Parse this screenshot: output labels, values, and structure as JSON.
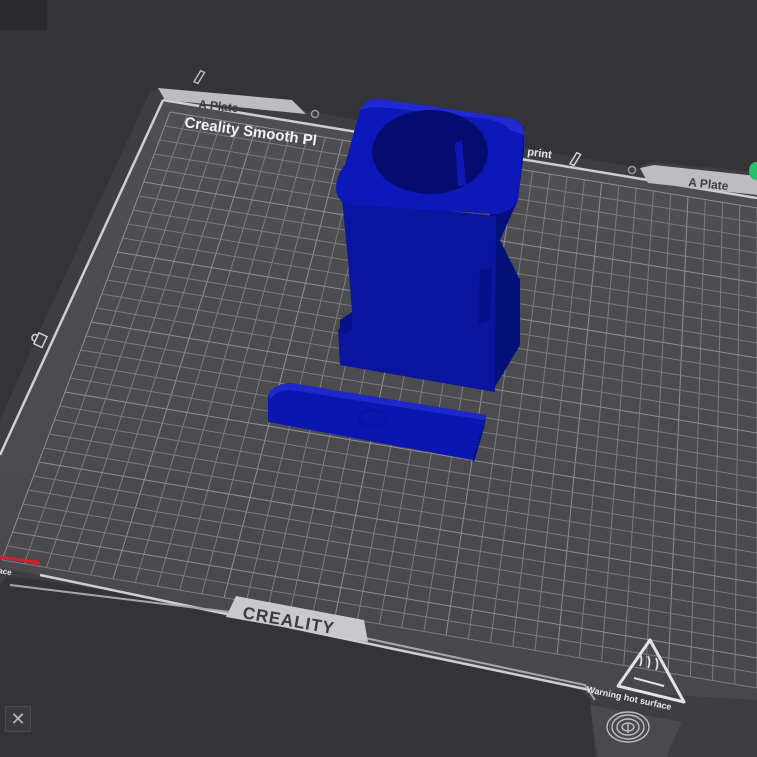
{
  "plate": {
    "tab_left": "A Plate",
    "tab_right": "A Plate",
    "name_label": "Creality Smooth Pl",
    "partial_label": "print",
    "brand": "CREALITY",
    "warning": "Warning hot surface",
    "partial_left_label": "ace"
  },
  "toolbar": {
    "close_label": "✕"
  },
  "colors": {
    "background": "#343438",
    "plate": "#4a4a4e",
    "grid": "#8a8a8f",
    "border": "#c8c8cc",
    "model": "#0a14b0",
    "model_dark": "#050d7a",
    "model_light": "#1a24c8",
    "status": "#25c06b"
  },
  "icons": {
    "close": "close-icon",
    "edit": "edit-icon",
    "lock": "lock-icon",
    "hot_surface": "hot-surface-warning-icon",
    "fingerprint": "fingerprint-icon"
  }
}
